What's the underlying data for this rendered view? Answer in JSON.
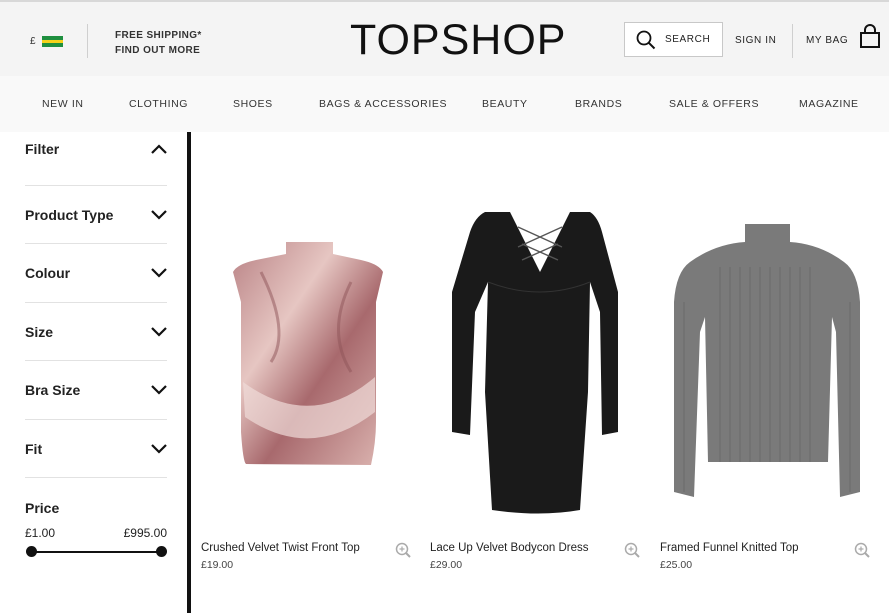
{
  "header": {
    "currency": "£",
    "shipping_line1": "FREE SHIPPING*",
    "shipping_line2": "FIND OUT MORE",
    "logo": "TOPSHOP",
    "search_label": "SEARCH",
    "signin_label": "SIGN IN",
    "bag_label": "MY BAG"
  },
  "nav": {
    "items": [
      "NEW IN",
      "CLOTHING",
      "SHOES",
      "BAGS & ACCESSORIES",
      "BEAUTY",
      "BRANDS",
      "SALE & OFFERS",
      "MAGAZINE"
    ]
  },
  "filters": {
    "title": "Filter",
    "items": [
      "Product Type",
      "Colour",
      "Size",
      "Bra Size",
      "Fit"
    ],
    "price": {
      "label": "Price",
      "min": "£1.00",
      "max": "£995.00"
    }
  },
  "products": [
    {
      "name": "Crushed Velvet Twist Front Top",
      "price": "£19.00",
      "image": "pink crushed velvet crop top"
    },
    {
      "name": "Lace Up Velvet Bodycon Dress",
      "price": "£29.00",
      "image": "black velvet lace up bodycon dress"
    },
    {
      "name": "Framed Funnel Knitted Top",
      "price": "£25.00",
      "image": "grey ribbed funnel neck knit top"
    }
  ],
  "colors": {
    "accent": "#111111",
    "topbar_bg": "#f4f4f4",
    "nav_bg": "#f9f9f9",
    "flag_stripes": [
      "#1f8f3f",
      "#f4d21a",
      "#1f8f3f"
    ]
  }
}
